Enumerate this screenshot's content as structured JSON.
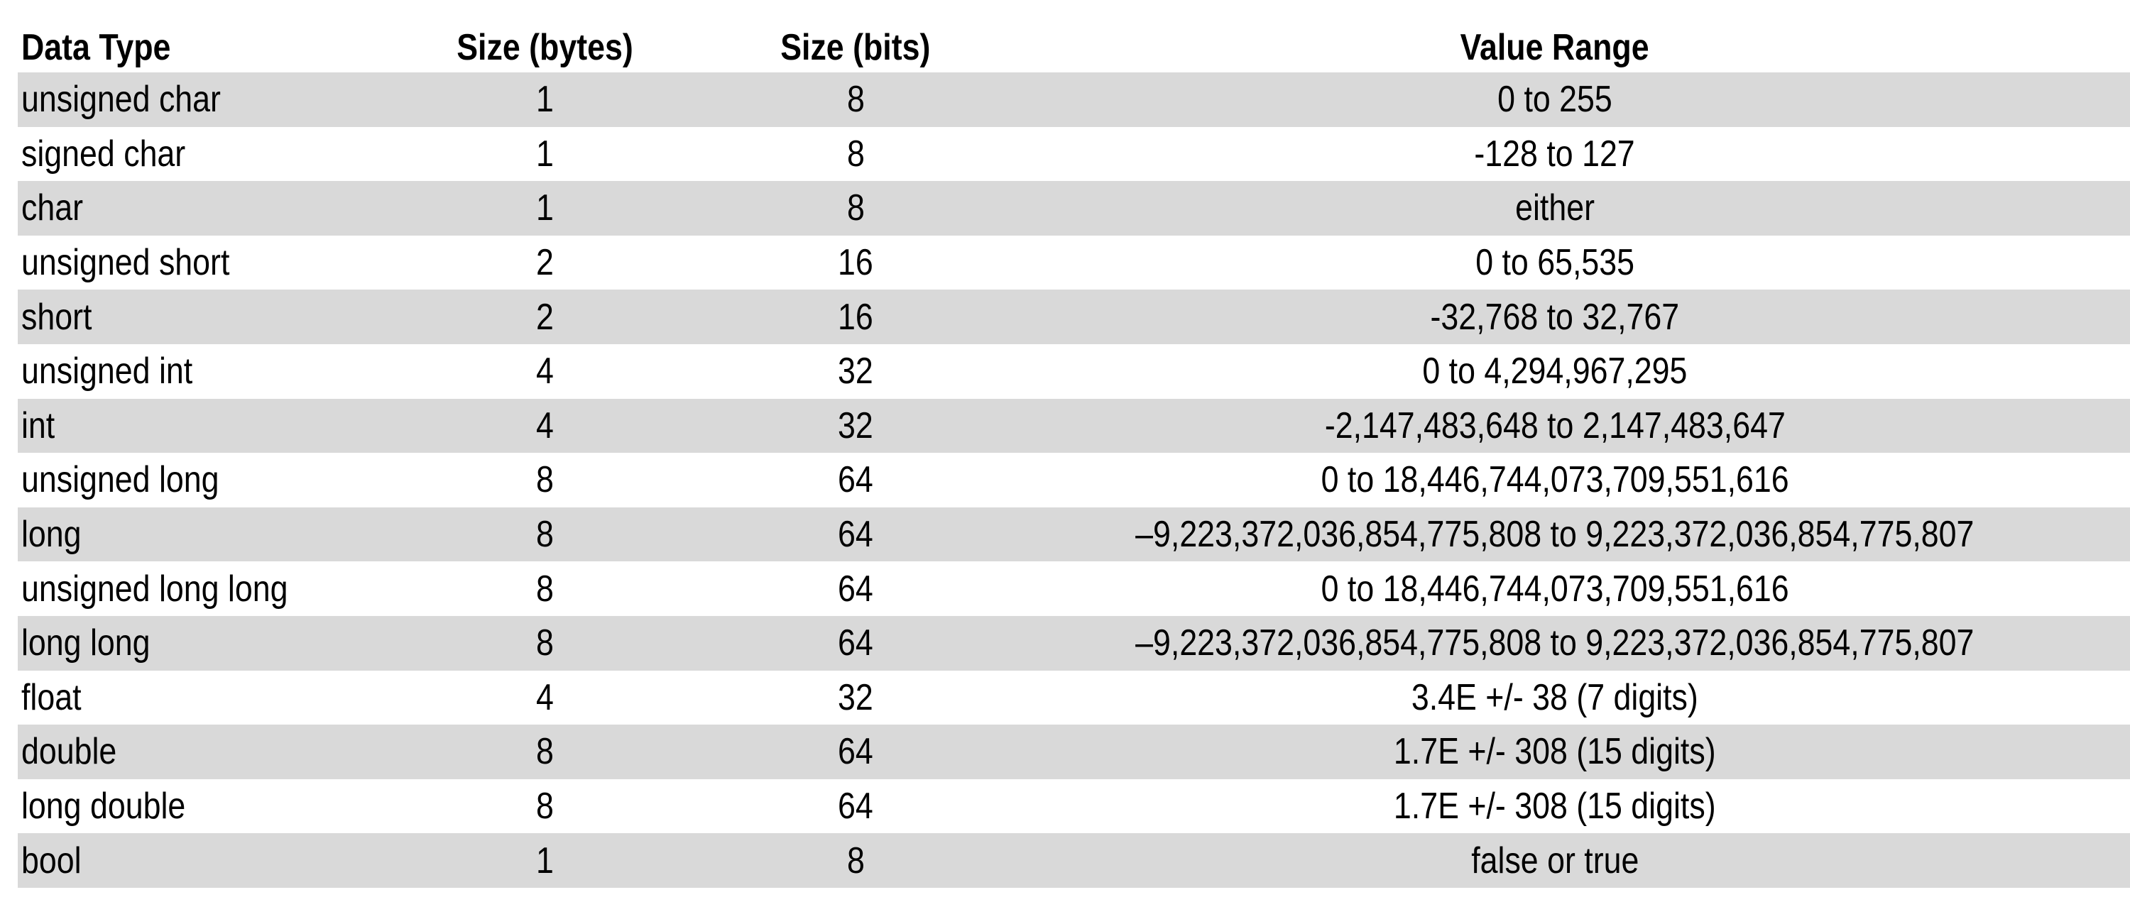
{
  "table": {
    "columns": [
      "Data Type",
      "Size (bytes)",
      "Size (bits)",
      "Value Range"
    ],
    "shaded_row_color": "#d9d9d9",
    "rows": [
      {
        "type": "unsigned char",
        "bytes": "1",
        "bits": "8",
        "range": "0 to 255"
      },
      {
        "type": "signed char",
        "bytes": "1",
        "bits": "8",
        "range": "-128 to 127"
      },
      {
        "type": "char",
        "bytes": "1",
        "bits": "8",
        "range": "either"
      },
      {
        "type": "unsigned short",
        "bytes": "2",
        "bits": "16",
        "range": "0 to 65,535"
      },
      {
        "type": "short",
        "bytes": "2",
        "bits": "16",
        "range": "-32,768 to 32,767"
      },
      {
        "type": "unsigned int",
        "bytes": "4",
        "bits": "32",
        "range": "0 to 4,294,967,295"
      },
      {
        "type": "int",
        "bytes": "4",
        "bits": "32",
        "range": "-2,147,483,648 to 2,147,483,647"
      },
      {
        "type": "unsigned long",
        "bytes": "8",
        "bits": "64",
        "range": "0 to 18,446,744,073,709,551,616"
      },
      {
        "type": "long",
        "bytes": "8",
        "bits": "64",
        "range": "–9,223,372,036,854,775,808 to 9,223,372,036,854,775,807"
      },
      {
        "type": "unsigned long long",
        "bytes": "8",
        "bits": "64",
        "range": "0 to 18,446,744,073,709,551,616"
      },
      {
        "type": "long long",
        "bytes": "8",
        "bits": "64",
        "range": "–9,223,372,036,854,775,808 to 9,223,372,036,854,775,807"
      },
      {
        "type": "float",
        "bytes": "4",
        "bits": "32",
        "range": "3.4E +/- 38 (7 digits)"
      },
      {
        "type": "double",
        "bytes": "8",
        "bits": "64",
        "range": "1.7E +/- 308 (15 digits)"
      },
      {
        "type": "long double",
        "bytes": "8",
        "bits": "64",
        "range": "1.7E +/- 308 (15 digits)"
      },
      {
        "type": "bool",
        "bytes": "1",
        "bits": "8",
        "range": "false or true"
      }
    ]
  }
}
